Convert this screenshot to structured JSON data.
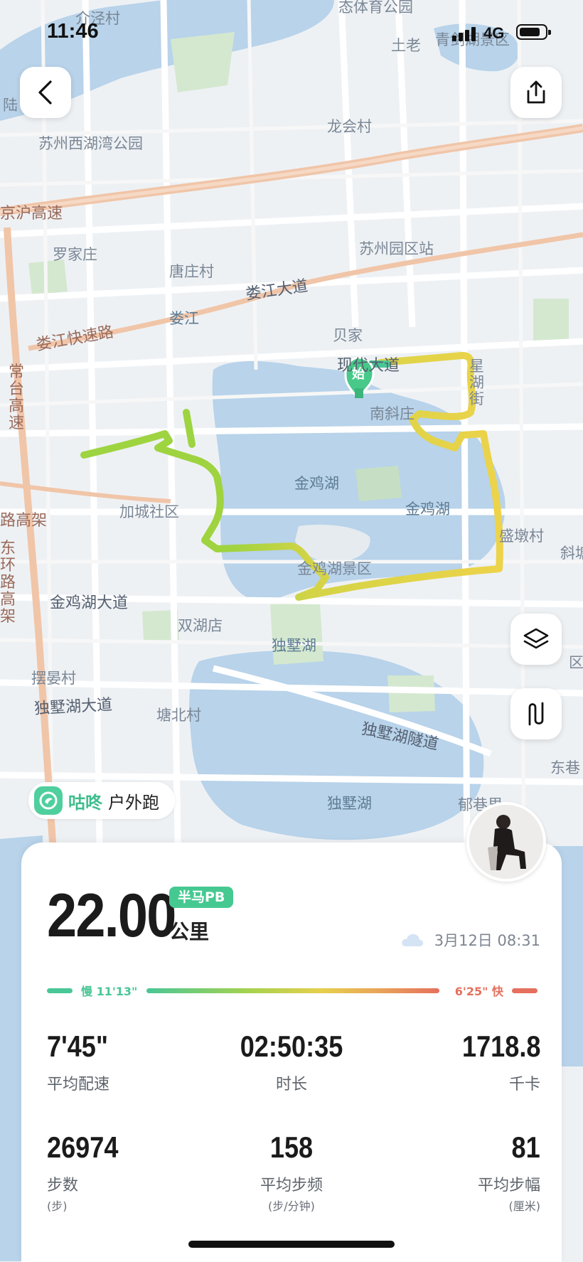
{
  "status_bar": {
    "time": "11:46",
    "network": "4G"
  },
  "map": {
    "labels": {
      "park_top": "态体育公园",
      "village_top_left": "介泾村",
      "tulao": "土老",
      "qingjian": "青剑湖景区",
      "lu": "陆",
      "west_lake_park": "苏州西湖湾公园",
      "longhui": "龙会村",
      "hu_expressway": "京沪高速",
      "luojia": "罗家庄",
      "station": "苏州园区站",
      "tangzhuang": "唐庄村",
      "loujiang_ave": "娄江大道",
      "loujiang": "娄江",
      "loujiang_express": "娄江快速路",
      "changtai": "常台高速",
      "beijia": "贝家",
      "xiandai": "现代大道",
      "start": "始",
      "nanxie": "南斜庄",
      "xinghu": "星湖街",
      "jinji_lake_1": "金鸡湖",
      "jinji_lake_2": "金鸡湖",
      "jiacheng": "加城社区",
      "lugao": "路高架",
      "shengdun": "盛墩村",
      "xie": "斜塘",
      "dongfang": "东环路高架",
      "jinji_scenic": "金鸡湖景区",
      "jinji_ave": "金鸡湖大道",
      "shuanghu": "双湖店",
      "dushu_lake_small": "独墅湖",
      "baiyan": "摆晏村",
      "dushu_ave": "独墅湖大道",
      "tangbei": "塘北村",
      "dushu_tunnel": "独墅湖隧道",
      "dongji": "东巷",
      "dushu_lake": "独墅湖",
      "duxiang": "郁巷里",
      "zone": "区"
    }
  },
  "brand": {
    "name": "咕咚",
    "type": "户外跑"
  },
  "summary": {
    "distance": "22.00",
    "badge": "半马PB",
    "unit": "公里",
    "datetime": "3月12日 08:31",
    "pace_slow": "慢 11'13\"",
    "pace_fast": "6'25\" 快"
  },
  "stats": [
    {
      "value": "7'45\"",
      "label": "平均配速",
      "sub": ""
    },
    {
      "value": "02:50:35",
      "label": "时长",
      "sub": ""
    },
    {
      "value": "1718.8",
      "label": "千卡",
      "sub": ""
    },
    {
      "value": "26974",
      "label": "步数",
      "sub": "(步)"
    },
    {
      "value": "158",
      "label": "平均步频",
      "sub": "(步/分钟)"
    },
    {
      "value": "81",
      "label": "平均步幅",
      "sub": "(厘米)"
    }
  ],
  "colors": {
    "accent": "#45c991",
    "route_start": "#8ccf3f",
    "route_end": "#e9cf45",
    "fast": "#e5705d"
  }
}
